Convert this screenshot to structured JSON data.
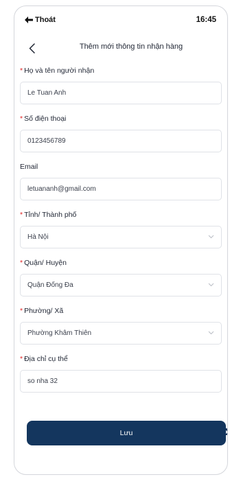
{
  "status_bar": {
    "back_label": "Thoát",
    "time": "16:45"
  },
  "header": {
    "title": "Thêm mới thông tin nhận hàng"
  },
  "form": {
    "required_mark": "*",
    "fields": [
      {
        "label": "Họ và tên người nhận",
        "value": "Le Tuan Anh"
      },
      {
        "label": "Số điện thoại",
        "value": "0123456789"
      },
      {
        "label": "Email",
        "value": "letuananh@gmail.com"
      },
      {
        "label": "Tỉnh/ Thành phố",
        "value": "Hà Nội"
      },
      {
        "label": "Quận/ Huyện",
        "value": "Quận Đống Đa"
      },
      {
        "label": "Phường/ Xã",
        "value": "Phường Khâm Thiên"
      },
      {
        "label": "Địa chỉ cụ thể",
        "value": "so nha 32"
      }
    ]
  },
  "actions": {
    "save_label": "Lưu"
  },
  "colors": {
    "primary": "#14365e",
    "required": "#e02424",
    "border": "#dfe2e7"
  },
  "icons": {
    "status_back": "back-arrow-icon",
    "nav_back": "chevron-left-icon",
    "dropdown": "chevron-down-icon"
  }
}
